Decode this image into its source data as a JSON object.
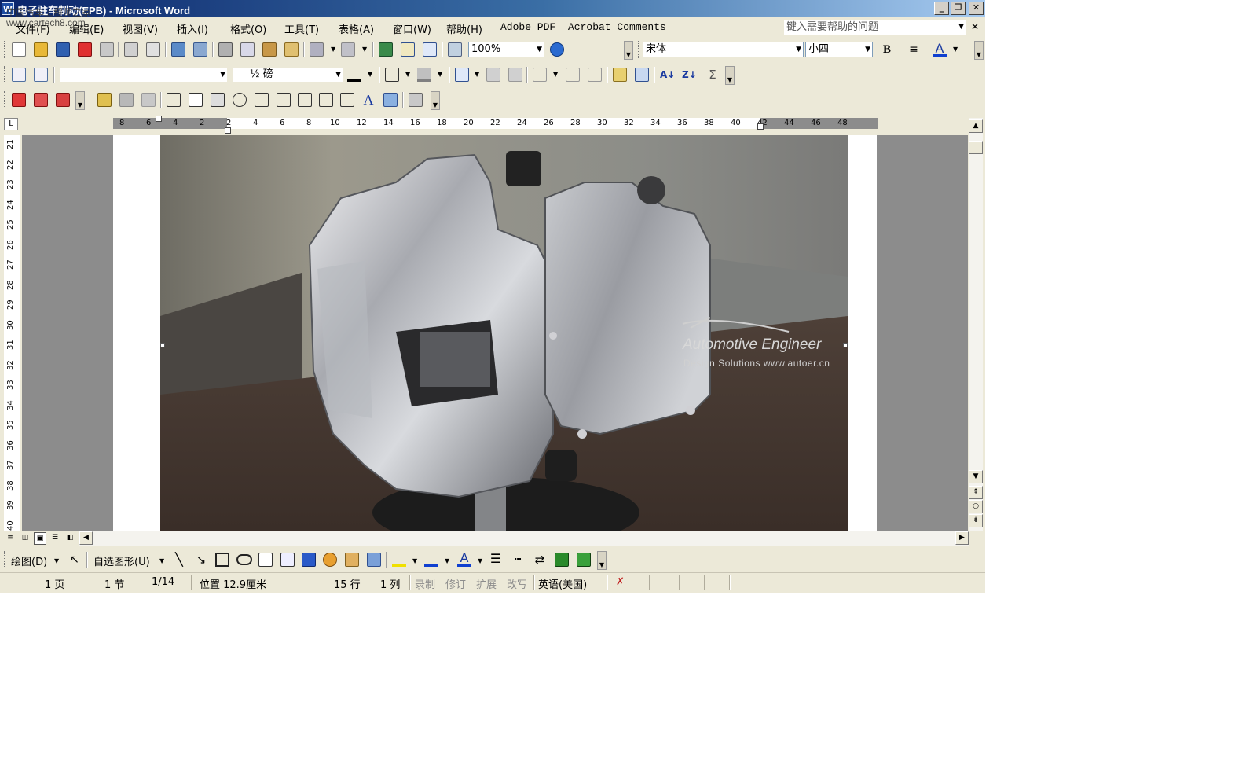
{
  "window": {
    "title": "电子驻车制动(EPB) - Microsoft Word",
    "app_icon_glyph": "W",
    "watermark_line1": "中国汽车工程师之家",
    "watermark_line2": "www.cartech8.com",
    "minimize_glyph": "_",
    "restore_glyph": "❐",
    "close_glyph": "✕"
  },
  "menu": {
    "items": [
      "文件(F)",
      "编辑(E)",
      "视图(V)",
      "插入(I)",
      "格式(O)",
      "工具(T)",
      "表格(A)",
      "窗口(W)",
      "帮助(H)",
      "Adobe PDF",
      "Acrobat Comments"
    ],
    "help_placeholder": "键入需要帮助的问题",
    "close_glyph": "✕"
  },
  "standard_toolbar": {
    "zoom": "100%",
    "font_name": "宋体",
    "font_size": "小四",
    "bold_glyph": "B",
    "font_color_glyph": "A"
  },
  "tables_toolbar": {
    "line_weight": "½ 磅",
    "sort_asc_glyph": "A↓",
    "sort_desc_glyph": "Z↓",
    "autosum_glyph": "Σ"
  },
  "forms_toolbar": {
    "text_glyph": "A"
  },
  "ruler": {
    "corner_glyph": "L",
    "horizontal_labels": [
      "8",
      "6",
      "4",
      "2",
      "2",
      "4",
      "6",
      "8",
      "10",
      "12",
      "14",
      "16",
      "18",
      "20",
      "22",
      "24",
      "26",
      "28",
      "30",
      "32",
      "34",
      "36",
      "38",
      "40",
      "42",
      "44",
      "46",
      "48"
    ],
    "vertical_labels": [
      "21",
      "22",
      "23",
      "24",
      "25",
      "26",
      "27",
      "28",
      "29",
      "30",
      "31",
      "32",
      "33",
      "34",
      "35",
      "36",
      "37",
      "38",
      "39",
      "40"
    ]
  },
  "document": {
    "image_caption_line1": "Automotive Engineer",
    "image_caption_line2": "Design  Solutions www.autoer.cn"
  },
  "scrollbar": {
    "up_glyph": "▲",
    "down_glyph": "▼",
    "prev_page_glyph": "⇞",
    "browse_object_glyph": "○",
    "next_page_glyph": "⇟",
    "left_glyph": "◀",
    "right_glyph": "▶"
  },
  "drawing_toolbar": {
    "draw_label": "绘图(D)",
    "autoshapes_label": "自选图形(U)"
  },
  "status_bar": {
    "page": "1 页",
    "section": "1 节",
    "page_of": "1/14",
    "position": "位置 12.9厘米",
    "line": "15 行",
    "column": "1 列",
    "rec": "录制",
    "trk": "修订",
    "ext": "扩展",
    "ovr": "改写",
    "language": "英语(美国)",
    "spell_icon": "spelling-check-icon",
    "spell_glyph": "✗"
  },
  "colors": {
    "title_gradient_start": "#0a246a",
    "title_gradient_end": "#a6caf0",
    "chrome": "#ece9d8",
    "doc_background": "#8c8c8c"
  }
}
